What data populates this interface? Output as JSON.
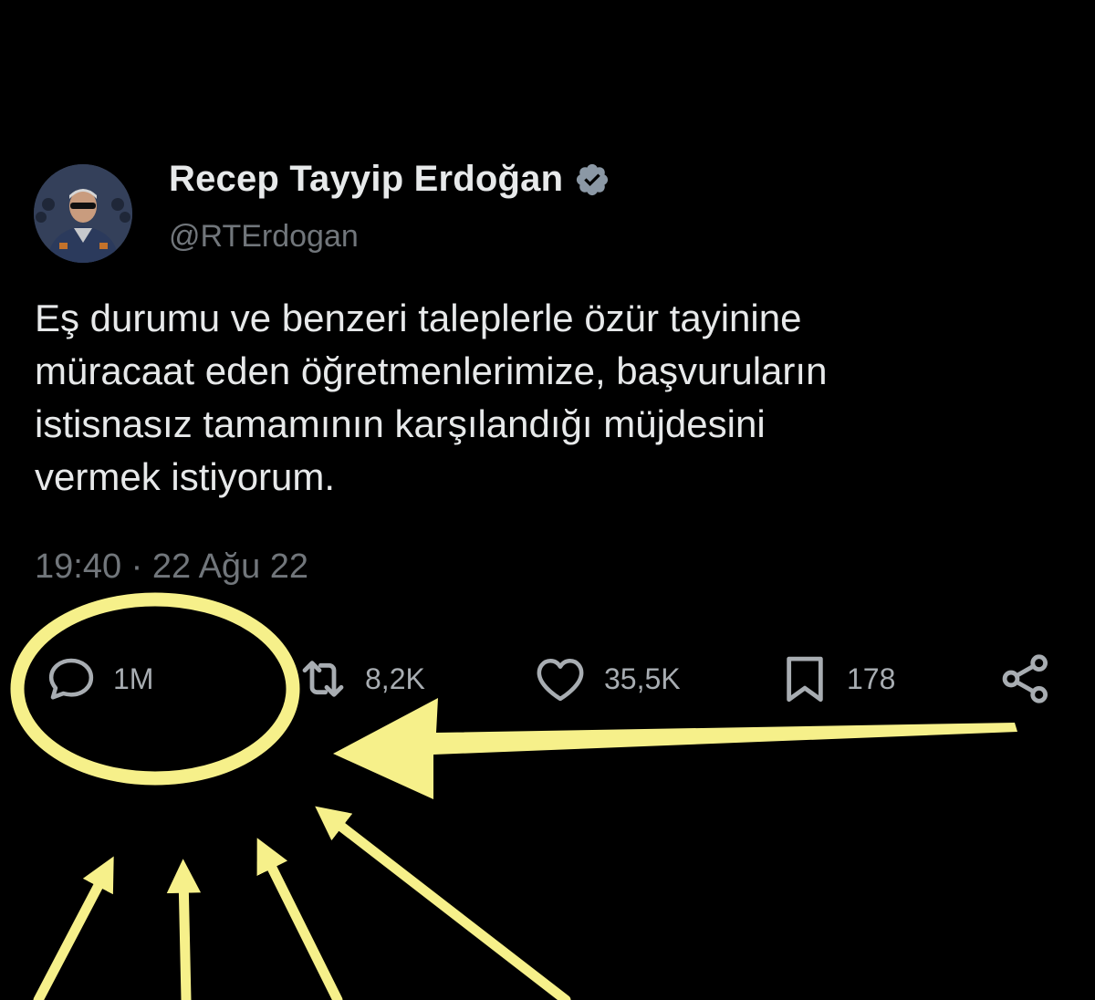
{
  "tweet": {
    "author": {
      "display_name": "Recep Tayyip Erdoğan",
      "handle": "@RTErdogan",
      "verified_icon": "verified-badge-icon",
      "avatar_icon": "avatar"
    },
    "text_lines": [
      "Eş durumu ve benzeri taleplerle özür tayinine",
      "müracaat eden öğretmenlerimize, başvuruların",
      "istisnasız tamamının karşılandığı müjdesini",
      "vermek istiyorum."
    ],
    "timestamp": "19:40 · 22 Ağu 22",
    "actions": {
      "reply": {
        "icon": "reply-icon",
        "count": "1M"
      },
      "retweet": {
        "icon": "retweet-icon",
        "count": "8,2K"
      },
      "like": {
        "icon": "heart-icon",
        "count": "35,5K"
      },
      "bookmark": {
        "icon": "bookmark-icon",
        "count": "178"
      },
      "share": {
        "icon": "share-icon"
      }
    }
  },
  "annotation": {
    "color": "#f6f08a",
    "shapes": [
      "ellipse-highlight",
      "arrow"
    ]
  },
  "colors": {
    "background": "#000000",
    "primary_text": "#e7e9ea",
    "secondary_text": "#71767b",
    "icon": "#a8adb2"
  }
}
